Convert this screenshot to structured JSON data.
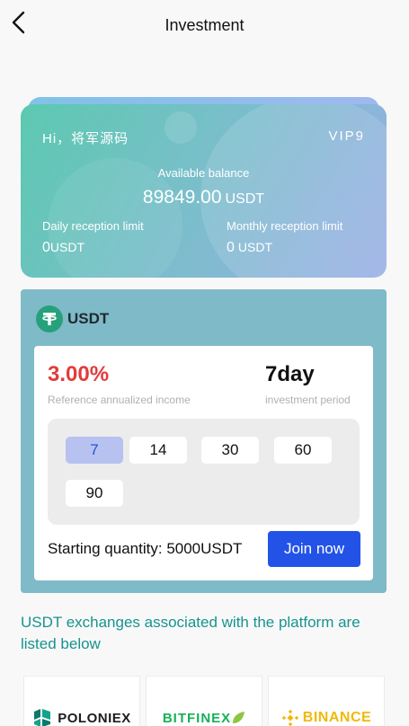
{
  "header": {
    "title": "Investment"
  },
  "card": {
    "greeting": "Hi，将军源码",
    "vip": "VIP9",
    "balance_label": "Available balance",
    "balance_value": "89849.00",
    "balance_unit": "USDT",
    "daily_label": "Daily reception limit",
    "daily_value": "0",
    "daily_unit": "USDT",
    "monthly_label": "Monthly reception limit",
    "monthly_value": "0",
    "monthly_unit": "USDT"
  },
  "product": {
    "coin": "USDT",
    "rate": "3.00%",
    "rate_label": "Reference annualized income",
    "period": "7day",
    "period_label": "investment period",
    "days": [
      "7",
      "14",
      "30",
      "60",
      "90"
    ],
    "selected_day": "7",
    "starting_label": "Starting quantity:",
    "starting_value": "5000USDT",
    "join_label": "Join now"
  },
  "exchanges_note": "USDT exchanges associated with the platform are listed below",
  "exchanges": [
    "POLONIEX",
    "BITFINEX",
    "BINANCE"
  ],
  "colors": {
    "accent": "#2353e6",
    "rate": "#e13c3c",
    "teal_text": "#17948f",
    "panel": "#7fbac8",
    "tether": "#26a17b",
    "binance": "#f0b90b",
    "bitfinex": "#16b157"
  },
  "icons": {
    "back": "chevron-left-icon",
    "coin": "tether-icon",
    "poloniex": "poloniex-logo-icon",
    "bitfinex": "bitfinex-leaf-icon",
    "binance": "binance-logo-icon"
  }
}
